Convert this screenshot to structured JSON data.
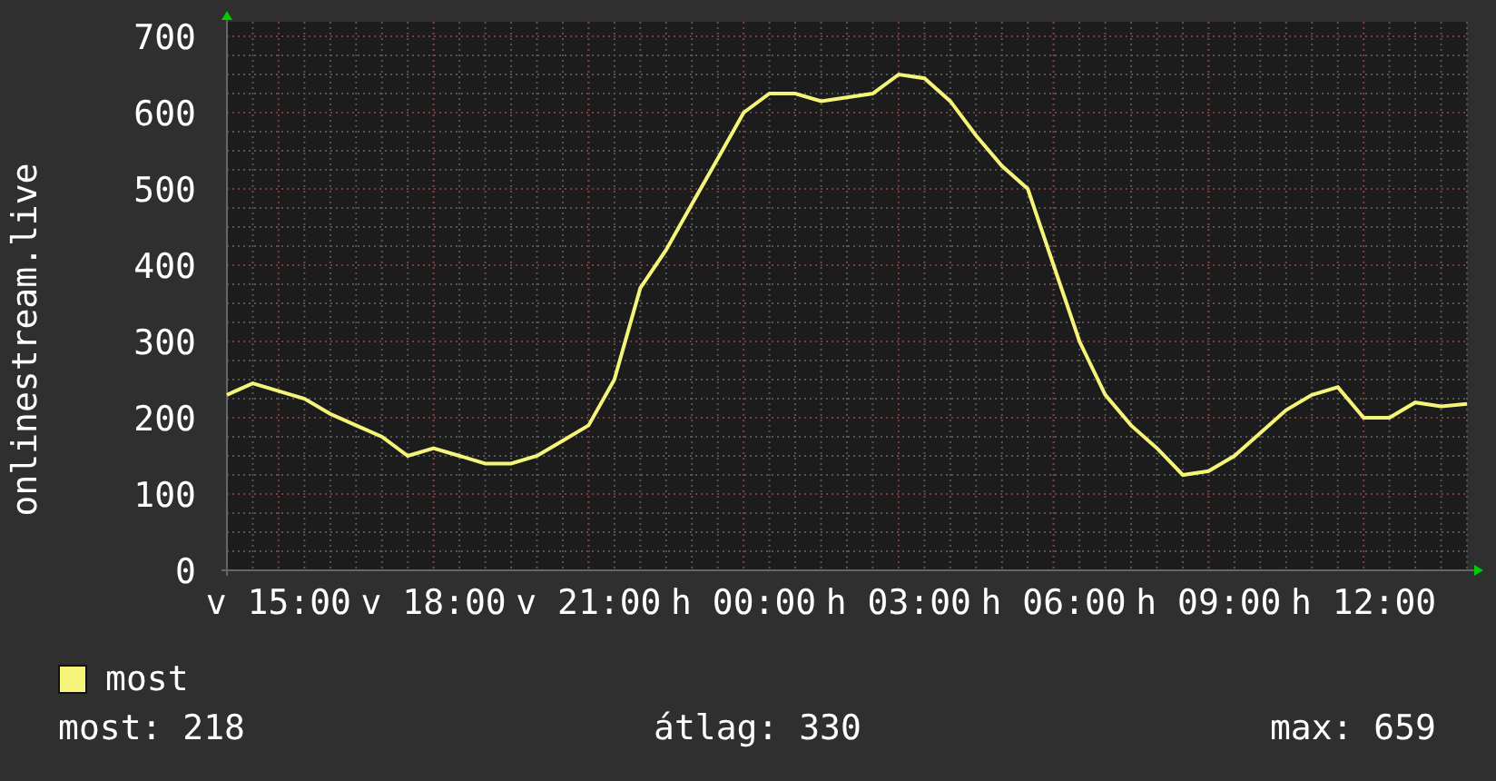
{
  "graph": {
    "chart_data": {
      "type": "line",
      "ylabel": "onlinestream.live",
      "categories": [
        null,
        null,
        "v 15:00",
        null,
        null,
        null,
        null,
        null,
        "v 18:00",
        null,
        null,
        null,
        null,
        null,
        "v 21:00",
        null,
        null,
        null,
        null,
        null,
        "h 00:00",
        null,
        null,
        null,
        null,
        null,
        "h 03:00",
        null,
        null,
        null,
        null,
        null,
        "h 06:00",
        null,
        null,
        null,
        null,
        null,
        "h 09:00",
        null,
        null,
        null,
        null,
        null,
        "h 12:00",
        null,
        null,
        null,
        null
      ],
      "series": [
        {
          "name": "most",
          "color": "#f5f57a",
          "values": [
            230,
            245,
            235,
            225,
            205,
            190,
            175,
            150,
            160,
            150,
            140,
            140,
            150,
            170,
            190,
            250,
            370,
            420,
            480,
            540,
            600,
            625,
            625,
            615,
            620,
            625,
            650,
            645,
            615,
            570,
            530,
            500,
            400,
            300,
            230,
            190,
            160,
            125,
            130,
            150,
            180,
            210,
            230,
            240,
            200,
            200,
            220,
            215,
            218
          ]
        }
      ],
      "grid": true,
      "ylim": [
        0,
        700
      ],
      "yticks": [
        0,
        100,
        200,
        300,
        400,
        500,
        600,
        700
      ]
    }
  },
  "stats": [
    "most: 218",
    "átlag: 330",
    "max: 659"
  ]
}
